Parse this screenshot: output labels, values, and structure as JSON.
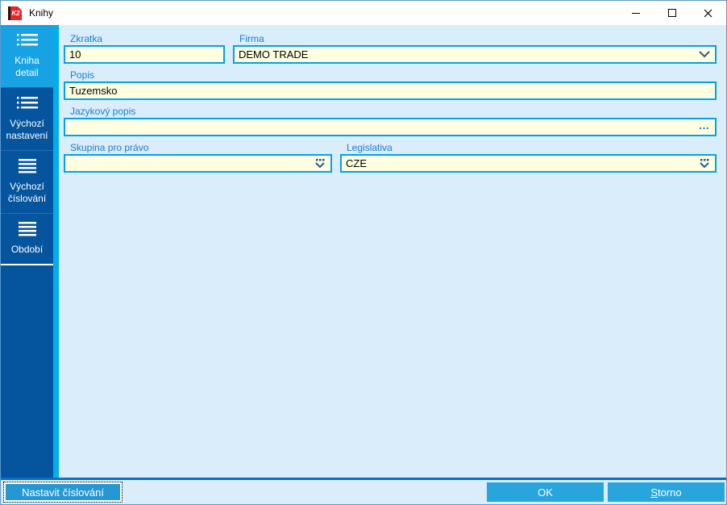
{
  "window": {
    "title": "Knihy",
    "logo_text": "K2"
  },
  "titlebar": {
    "icons": [
      "app-logo-k2",
      "minimize-icon",
      "maximize-icon",
      "close-icon"
    ]
  },
  "sidebar": {
    "items": [
      {
        "label": "Kniha detail",
        "icon": "detail-list-icon",
        "active": true
      },
      {
        "label": "Výchozí nastavení",
        "icon": "detail-list-icon",
        "active": false
      },
      {
        "label": "Výchozí číslování",
        "icon": "menu-lines-icon",
        "active": false
      },
      {
        "label": "Období",
        "icon": "menu-lines-icon",
        "active": false
      }
    ]
  },
  "form": {
    "zkratka": {
      "label": "Zkratka",
      "value": "10"
    },
    "firma": {
      "label": "Firma",
      "value": "DEMO TRADE",
      "icon": "chevron-down-icon"
    },
    "popis": {
      "label": "Popis",
      "value": "Tuzemsko"
    },
    "jazykovy": {
      "label": "Jazykový popis",
      "value": "",
      "button_label": "…",
      "icon": "ellipsis-icon"
    },
    "skupina": {
      "label": "Skupina pro právo",
      "value": "",
      "icon": "dots-chevron-icon"
    },
    "legislativa": {
      "label": "Legislativa",
      "value": "CZE",
      "icon": "dots-chevron-icon"
    }
  },
  "footer": {
    "nastavit_label": "Nastavit číslování",
    "ok_label": "OK",
    "storno_accel": "S",
    "storno_rest": "torno"
  },
  "colors": {
    "sidebar_bg": "#05549e",
    "sidebar_active_bg": "#17a2e4",
    "accent_strip": "#00aeef",
    "content_bg": "#d9edfa",
    "field_bg": "#ffffe1",
    "field_border": "#00a3e8",
    "label_text": "#1b7dd2",
    "button_bg": "#29a5de",
    "footer_line": "#0a6ec5",
    "logo_red": "#e5252a"
  }
}
